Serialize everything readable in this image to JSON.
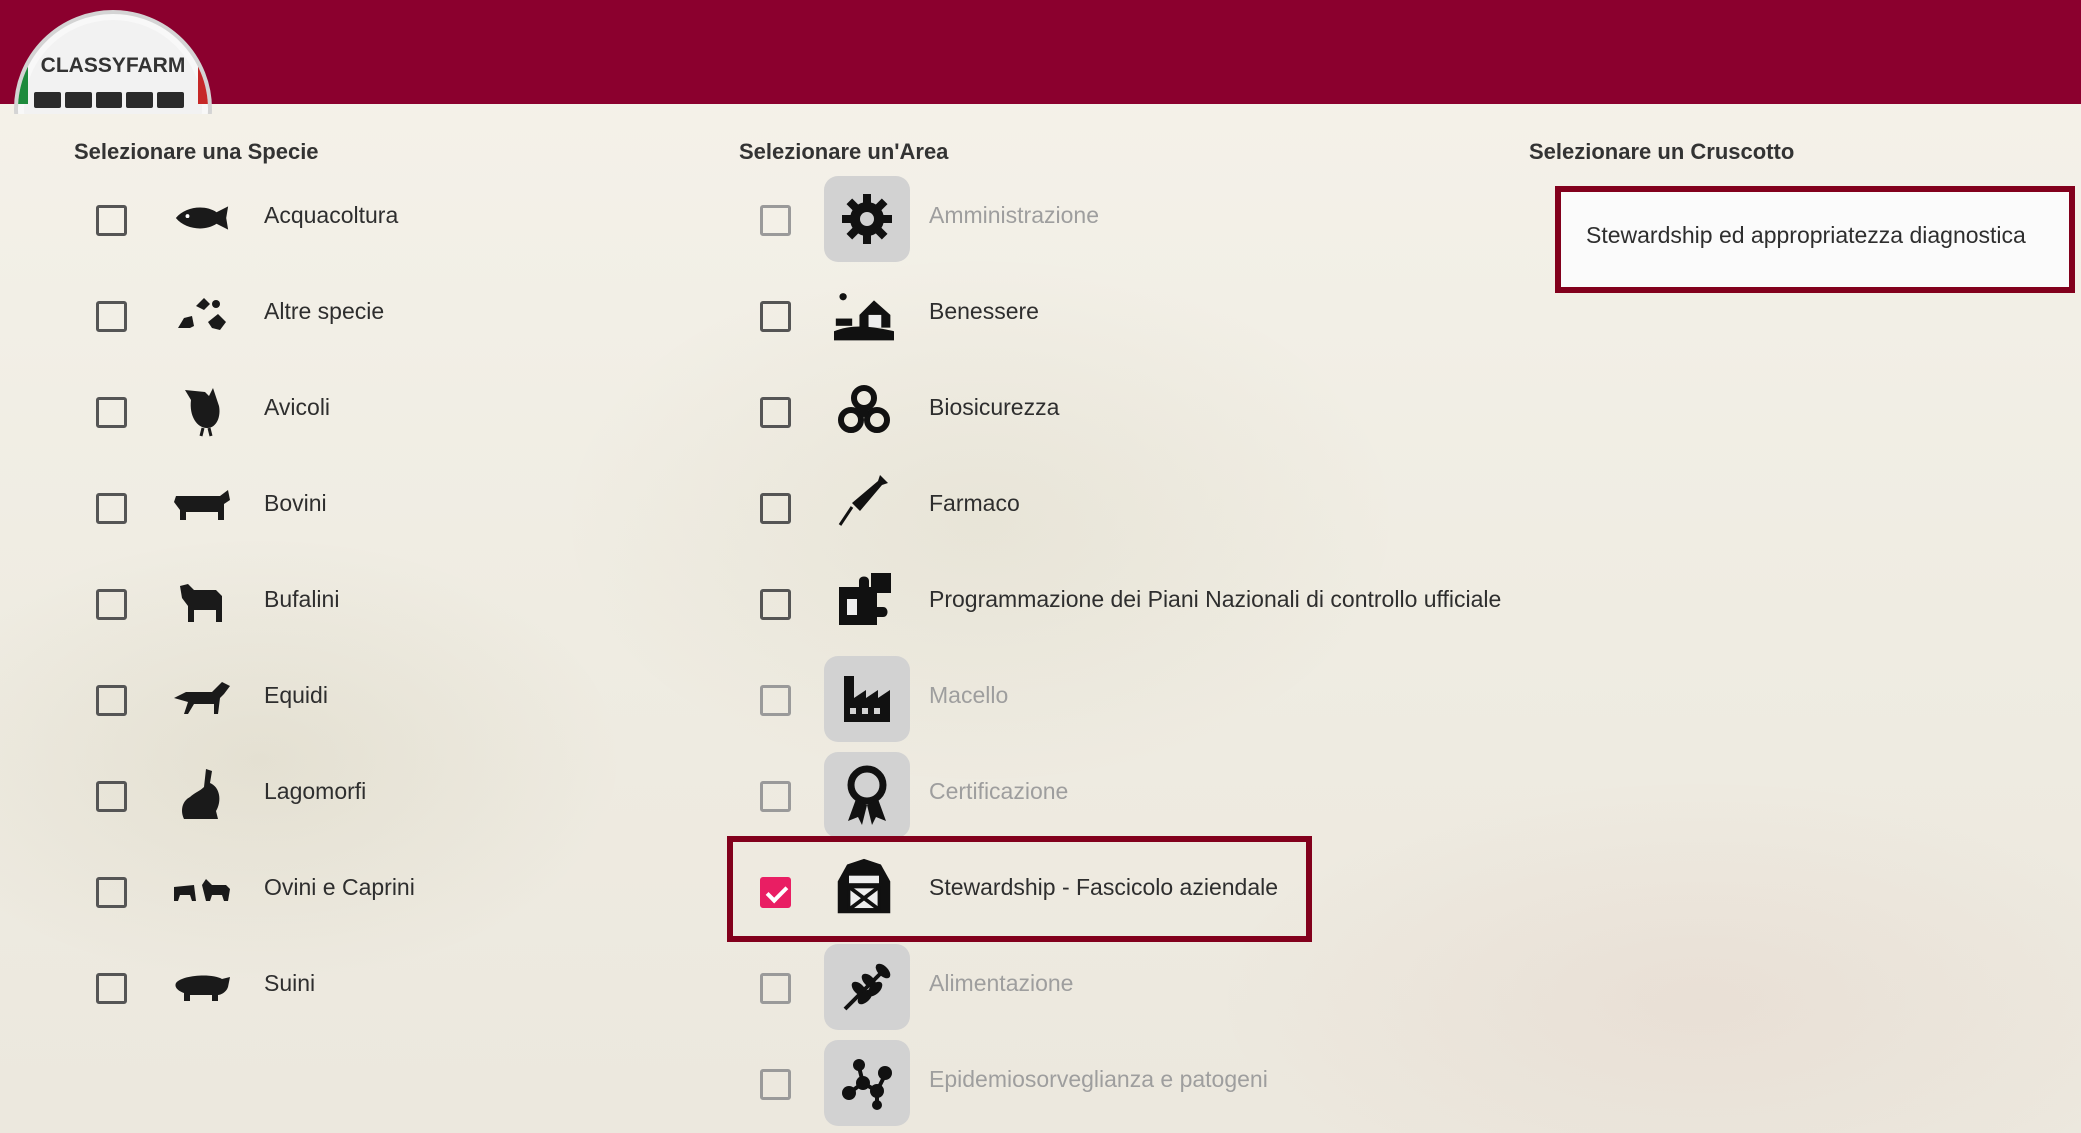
{
  "app": {
    "logo_text": "CLASSYFARM",
    "colors": {
      "topbar": "#8b002e",
      "highlight": "#82001c",
      "checkbox_checked": "#e91e63"
    }
  },
  "species": {
    "header": "Selezionare una Specie",
    "items": [
      {
        "label": "Acquacoltura",
        "icon": "fish-icon",
        "checked": false
      },
      {
        "label": "Altre specie",
        "icon": "other-animals-icon",
        "checked": false
      },
      {
        "label": "Avicoli",
        "icon": "chicken-icon",
        "checked": false
      },
      {
        "label": "Bovini",
        "icon": "cow-icon",
        "checked": false
      },
      {
        "label": "Bufalini",
        "icon": "buffalo-icon",
        "checked": false
      },
      {
        "label": "Equidi",
        "icon": "horse-icon",
        "checked": false
      },
      {
        "label": "Lagomorfi",
        "icon": "rabbit-icon",
        "checked": false
      },
      {
        "label": "Ovini e Caprini",
        "icon": "sheep-goat-icon",
        "checked": false
      },
      {
        "label": "Suini",
        "icon": "pig-icon",
        "checked": false
      }
    ]
  },
  "areas": {
    "header": "Selezionare un'Area",
    "items": [
      {
        "label": "Amministrazione",
        "icon": "gear-icon",
        "checked": false,
        "enabled": false
      },
      {
        "label": "Benessere",
        "icon": "farm-welfare-icon",
        "checked": false,
        "enabled": true
      },
      {
        "label": "Biosicurezza",
        "icon": "biohazard-icon",
        "checked": false,
        "enabled": true
      },
      {
        "label": "Farmaco",
        "icon": "syringe-icon",
        "checked": false,
        "enabled": true
      },
      {
        "label": "Programmazione dei Piani Nazionali di controllo ufficiale",
        "icon": "puzzle-icon",
        "checked": false,
        "enabled": true
      },
      {
        "label": "Macello",
        "icon": "factory-icon",
        "checked": false,
        "enabled": false
      },
      {
        "label": "Certificazione",
        "icon": "award-ribbon-icon",
        "checked": false,
        "enabled": false
      },
      {
        "label": "Stewardship - Fascicolo aziendale",
        "icon": "barn-icon",
        "checked": true,
        "enabled": true
      },
      {
        "label": "Alimentazione",
        "icon": "wheat-icon",
        "checked": false,
        "enabled": false
      },
      {
        "label": "Epidemiosorveglianza e patogeni",
        "icon": "molecule-icon",
        "checked": false,
        "enabled": false
      }
    ]
  },
  "dashboards": {
    "header": "Selezionare un Cruscotto",
    "items": [
      {
        "label": "Stewardship ed appropriatezza diagnostica"
      }
    ]
  }
}
